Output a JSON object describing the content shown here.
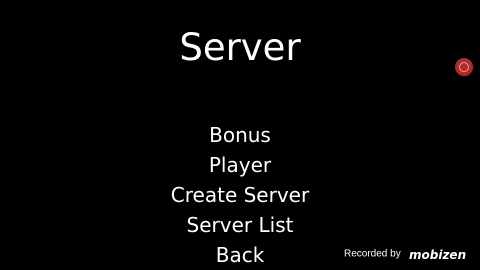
{
  "title": "Server",
  "menu": {
    "items": [
      {
        "id": "bonus",
        "label": "Bonus"
      },
      {
        "id": "player",
        "label": "Player"
      },
      {
        "id": "create-server",
        "label": "Create Server"
      },
      {
        "id": "server-list",
        "label": "Server List"
      },
      {
        "id": "back",
        "label": "Back"
      }
    ]
  },
  "watermark": {
    "text": "Recorded by",
    "brand": "mobizen"
  },
  "colors": {
    "background": "#000000",
    "text": "#ffffff",
    "recorder_icon": "#b02a2a"
  },
  "icons": {
    "recorder": "mobizen-record-icon"
  }
}
